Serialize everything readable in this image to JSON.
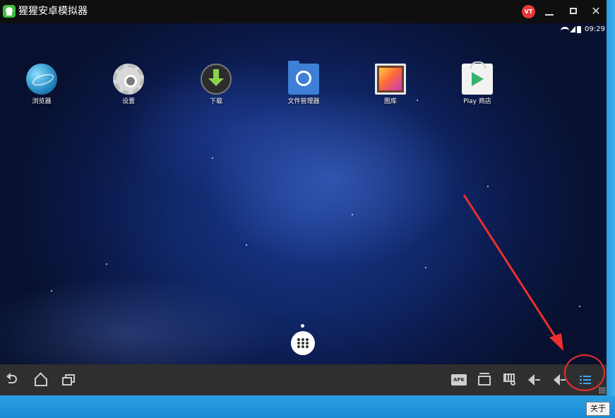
{
  "window": {
    "title": "猩猩安卓模拟器",
    "user_badge": "VT"
  },
  "statusbar": {
    "time": "09:29"
  },
  "apps": [
    {
      "label": "浏览器",
      "icon": "browser-icon"
    },
    {
      "label": "设置",
      "icon": "settings-gear-icon"
    },
    {
      "label": "下载",
      "icon": "download-icon"
    },
    {
      "label": "文件管理器",
      "icon": "file-manager-icon"
    },
    {
      "label": "图库",
      "icon": "gallery-icon"
    },
    {
      "label": "Play 商店",
      "icon": "play-store-icon"
    }
  ],
  "navbar": {
    "apk_label": "APK"
  },
  "desktop": {
    "about_label": "关于"
  },
  "colors": {
    "titlebar": "#0f0f10",
    "navbar": "#2f2f2f",
    "accent_menu": "#3da6ff",
    "annotation_red": "#ef2e2e",
    "desktop_blue": "#1c8fd9"
  }
}
